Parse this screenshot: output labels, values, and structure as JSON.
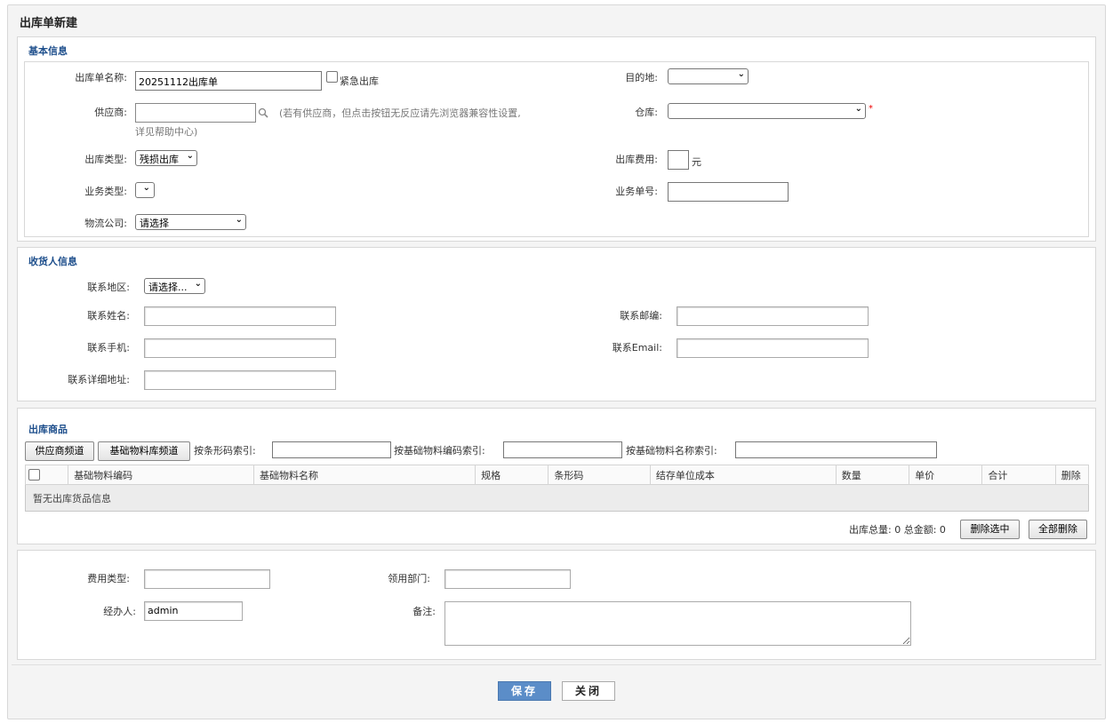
{
  "page": {
    "title": "出库单新建"
  },
  "basic": {
    "title": "基本信息",
    "name_label": "出库单名称:",
    "name_value": "20251112出库单",
    "urgent_label": "紧急出库",
    "dest_label": "目的地:",
    "supplier_label": "供应商:",
    "supplier_note_1": "(若有供应商，但点击按钮无反应请先浏览器兼容性设置,",
    "supplier_note_2": "详见帮助中心)",
    "warehouse_label": "仓库:",
    "required_mark": "*",
    "type_label": "出库类型:",
    "type_value": "残损出库",
    "fee_label": "出库费用:",
    "fee_unit": "元",
    "biz_type_label": "业务类型:",
    "biz_no_label": "业务单号:",
    "logistics_label": "物流公司:",
    "logistics_value": "请选择"
  },
  "receiver": {
    "title": "收货人信息",
    "region_label": "联系地区:",
    "region_value": "请选择...",
    "name_label": "联系姓名:",
    "zip_label": "联系邮编:",
    "mobile_label": "联系手机:",
    "email_label": "联系Email:",
    "address_label": "联系详细地址:"
  },
  "goods": {
    "title": "出库商品",
    "supplier_channel_btn": "供应商频道",
    "material_channel_btn": "基础物料库频道",
    "barcode_search_label": "按条形码索引:",
    "code_search_label": "按基础物料编码索引:",
    "name_search_label": "按基础物料名称索引:",
    "columns": [
      "基础物料编码",
      "基础物料名称",
      "规格",
      "条形码",
      "结存单位成本",
      "数量",
      "单价",
      "合计",
      "删除"
    ],
    "empty_text": "暂无出库货品信息",
    "summary": "出库总量: 0 总金额: 0",
    "delete_selected_btn": "删除选中",
    "delete_all_btn": "全部删除"
  },
  "extra": {
    "fee_type_label": "费用类型:",
    "dept_label": "领用部门:",
    "handler_label": "经办人:",
    "handler_value": "admin",
    "remark_label": "备注:"
  },
  "actions": {
    "save": "保存",
    "close": "关闭"
  }
}
